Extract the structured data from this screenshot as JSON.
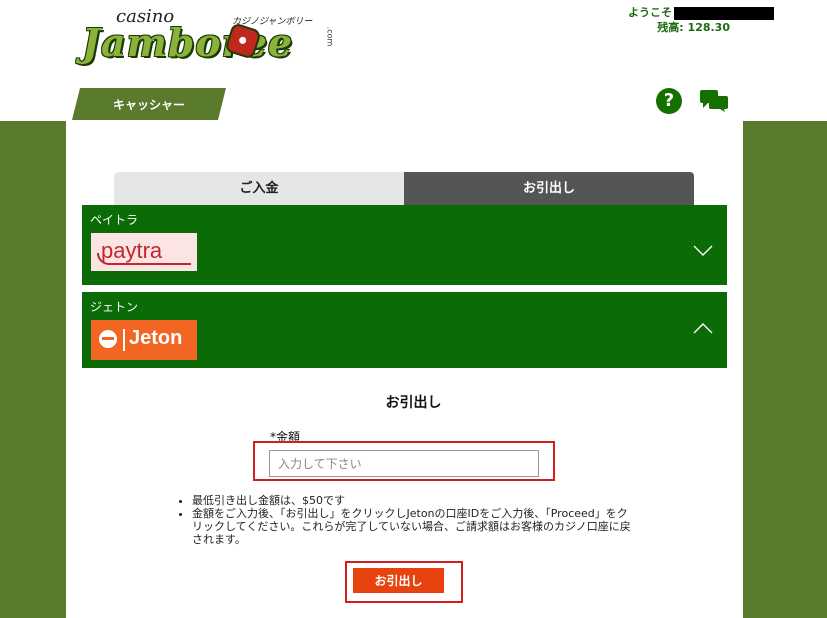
{
  "brand": {
    "logo_top": "casino",
    "logo_main": "Jamboree",
    "logo_kana": "カジノジャンボリー",
    "logo_suffix": ".com"
  },
  "account": {
    "welcome_label": "ようこそ",
    "balance_label": "残高:",
    "balance_value": "128.30"
  },
  "header": {
    "cashier_label": "キャッシャー",
    "help_icon": "question-circle-icon",
    "chat_icon": "chat-bubble-icon"
  },
  "tabs": [
    {
      "label": "ご入金",
      "active": false
    },
    {
      "label": "お引出し",
      "active": true
    }
  ],
  "methods": [
    {
      "name": "ペイトラ",
      "logo_text": "paytra",
      "expanded": false
    },
    {
      "name": "ジェトン",
      "logo_text": "Jeton",
      "expanded": true
    }
  ],
  "withdraw": {
    "title": "お引出し",
    "amount_label": "*金額",
    "amount_placeholder": "入力して下さい",
    "notes": [
      "最低引き出し金額は、$50です",
      "金額をご入力後、「お引出し」をクリックしJetonの口座IDをご入力後、「Proceed」をクリックしてください。これらが完了していない場合、ご請求額はお客様のカジノ口座に戻されます。"
    ],
    "button_label": "お引出し"
  },
  "colors": {
    "brand_green": "#5a7a2e",
    "panel_green": "#0b6b06",
    "accent_orange": "#e8420e",
    "highlight_red": "#d21e1e"
  }
}
